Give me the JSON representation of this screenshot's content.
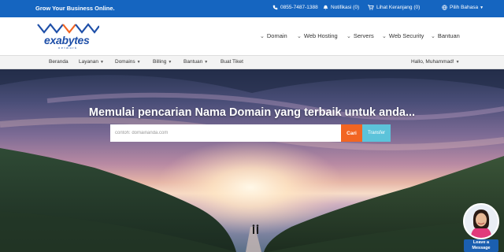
{
  "topbar": {
    "tagline": "Grow Your Business Online.",
    "phone": "0855-7487-1388",
    "notifications": "Notifikasi (0)",
    "cart": "Lihat Keranjang (0)",
    "language": "Pilih Bahasa"
  },
  "brand": {
    "logo_text": "exabytes",
    "logo_sub": "network",
    "color": "#1e4fa8"
  },
  "main_nav": [
    "Domain",
    "Web Hosting",
    "Servers",
    "Web Security",
    "Bantuan"
  ],
  "sub_nav": {
    "items": [
      {
        "label": "Beranda",
        "has_caret": false
      },
      {
        "label": "Layanan",
        "has_caret": true
      },
      {
        "label": "Domains",
        "has_caret": true
      },
      {
        "label": "Billing",
        "has_caret": true
      },
      {
        "label": "Bantuan",
        "has_caret": true
      },
      {
        "label": "Buat Tiket",
        "has_caret": false
      }
    ],
    "user_greeting": "Hallo, Muhammad!"
  },
  "hero": {
    "title": "Memulai pencarian Nama Domain yang terbaik untuk anda...",
    "search_placeholder": "contoh: domainanda.com",
    "search_button": "Cari",
    "transfer_button": "Transfer"
  },
  "chat_widget": {
    "label_line1": "Leave a",
    "label_line2": "Message"
  },
  "colors": {
    "topbar": "#1565c0",
    "search_button": "#f26522",
    "transfer_button": "#5cc3da"
  }
}
